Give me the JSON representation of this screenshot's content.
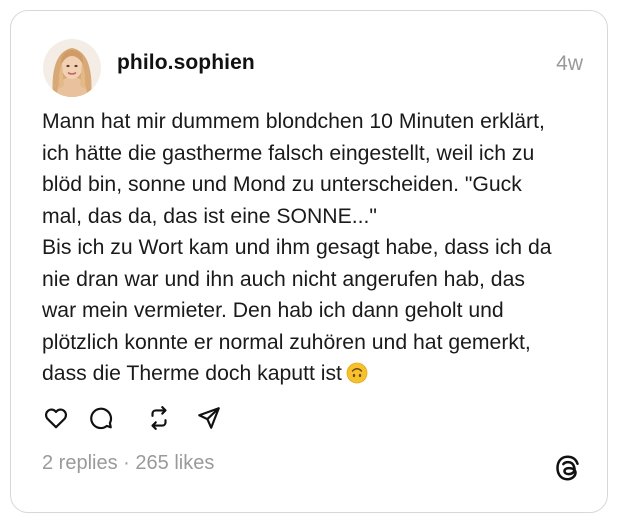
{
  "post": {
    "username": "philo.sophien",
    "timestamp": "4w",
    "text": "Mann hat mir dummem blondchen 10 Minuten erklärt,\nich hätte die gastherme falsch eingestellt, weil ich zu\nblöd bin, sonne und Mond zu unterscheiden. \"Guck\nmal, das da, das ist eine SONNE...\"\nBis ich zu Wort kam und ihm gesagt habe, dass ich da\nnie dran war und ihn auch nicht angerufen hab, das\nwar mein vermieter. Den hab ich dann geholt und\nplötzlich konnte er normal zuhören und hat gemerkt,\ndass die Therme doch kaputt ist",
    "emoji": "upside-down-face-emoji"
  },
  "actions": {
    "icons": [
      "heart-icon",
      "comment-icon",
      "repost-icon",
      "share-icon"
    ]
  },
  "stats": {
    "replies": "2 replies",
    "separator": " · ",
    "likes": "265 likes"
  },
  "brand": {
    "logo": "threads-logo-icon"
  },
  "colors": {
    "text": "#1a1a1a",
    "muted": "#9a9a9a",
    "border": "#d8d8d8",
    "emoji": "#f7c12e"
  }
}
